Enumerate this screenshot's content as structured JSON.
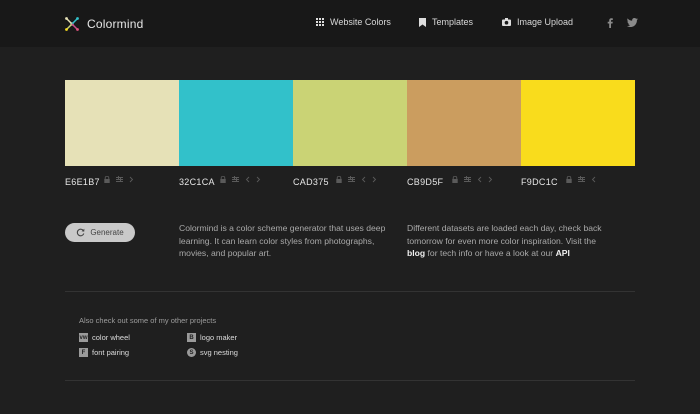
{
  "header": {
    "brand": "Colormind",
    "nav": [
      {
        "label": "Website Colors",
        "icon": "grid-icon"
      },
      {
        "label": "Templates",
        "icon": "bookmark-icon"
      },
      {
        "label": "Image Upload",
        "icon": "camera-icon"
      }
    ],
    "social": [
      "facebook-icon",
      "twitter-icon"
    ]
  },
  "palette": [
    {
      "hex": "E6E1B7",
      "color": "#E6E1B7"
    },
    {
      "hex": "32C1CA",
      "color": "#32C1CA"
    },
    {
      "hex": "CAD375",
      "color": "#CAD375"
    },
    {
      "hex": "CB9D5F",
      "color": "#CB9D5F"
    },
    {
      "hex": "F9DC1C",
      "color": "#F9DC1C"
    }
  ],
  "generate_label": "Generate",
  "description": "Colormind is a color scheme generator that uses deep learning. It can learn color styles from photographs, movies, and popular art.",
  "datasets": {
    "before_blog": "Different datasets are loaded each day, check back tomorrow for even more color inspiration. Visit the",
    "blog_link": "blog",
    "middle": "for tech info or have a look at our",
    "api_link": "API"
  },
  "projects": {
    "heading": "Also check out some of my other projects",
    "items": [
      {
        "label": "color wheel",
        "icon_text": "vw"
      },
      {
        "label": "logo maker",
        "icon_text": "B"
      },
      {
        "label": "font pairing",
        "icon_text": "F"
      },
      {
        "label": "svg nesting",
        "icon_text": "S"
      }
    ]
  }
}
